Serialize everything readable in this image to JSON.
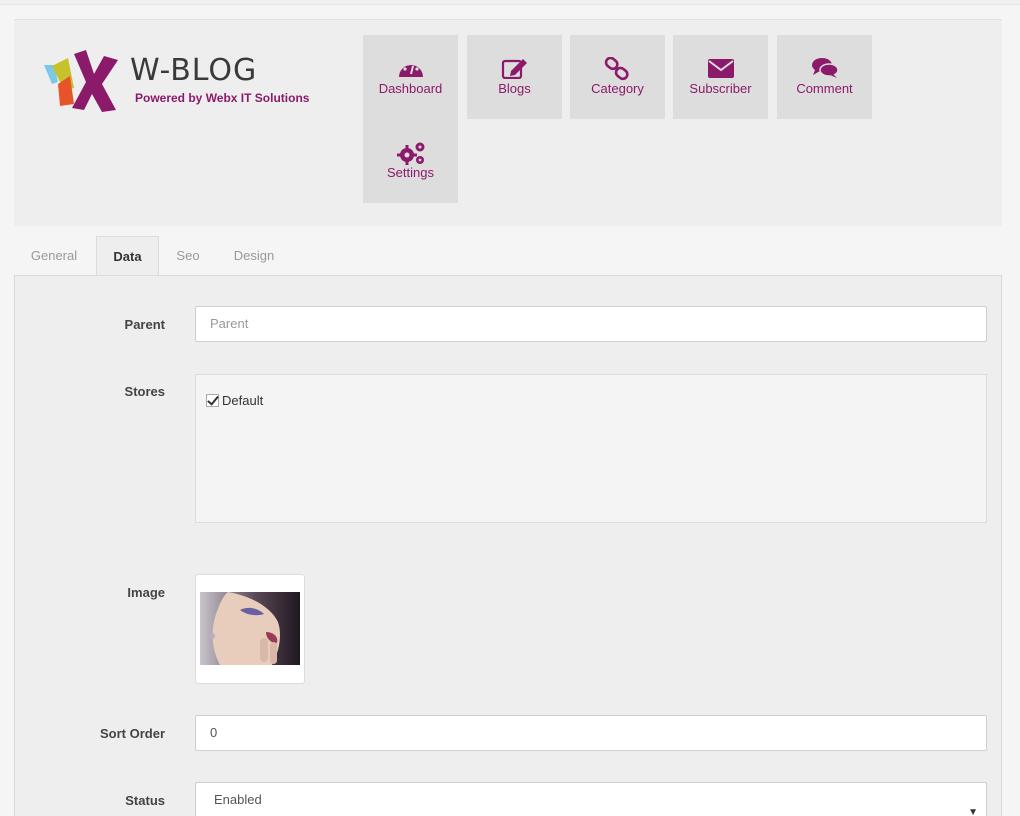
{
  "brand": {
    "name": "W-BLOG",
    "tagline": "Powered by Webx IT Solutions",
    "accent_color": "#8c1a6a"
  },
  "menu": [
    {
      "label": "Dashboard",
      "icon": "dashboard-icon"
    },
    {
      "label": "Blogs",
      "icon": "edit-icon"
    },
    {
      "label": "Category",
      "icon": "link-icon"
    },
    {
      "label": "Subscriber",
      "icon": "envelope-icon"
    },
    {
      "label": "Comment",
      "icon": "comments-icon"
    },
    {
      "label": "Settings",
      "icon": "gears-icon"
    }
  ],
  "tabs": [
    {
      "label": "General",
      "active": false
    },
    {
      "label": "Data",
      "active": true
    },
    {
      "label": "Seo",
      "active": false
    },
    {
      "label": "Design",
      "active": false
    }
  ],
  "form": {
    "parent": {
      "label": "Parent",
      "placeholder": "Parent",
      "value": ""
    },
    "stores": {
      "label": "Stores",
      "options": [
        {
          "label": "Default",
          "checked": true
        }
      ]
    },
    "image": {
      "label": "Image"
    },
    "sort_order": {
      "label": "Sort Order",
      "value": "0"
    },
    "status": {
      "label": "Status",
      "value": "Enabled"
    }
  }
}
